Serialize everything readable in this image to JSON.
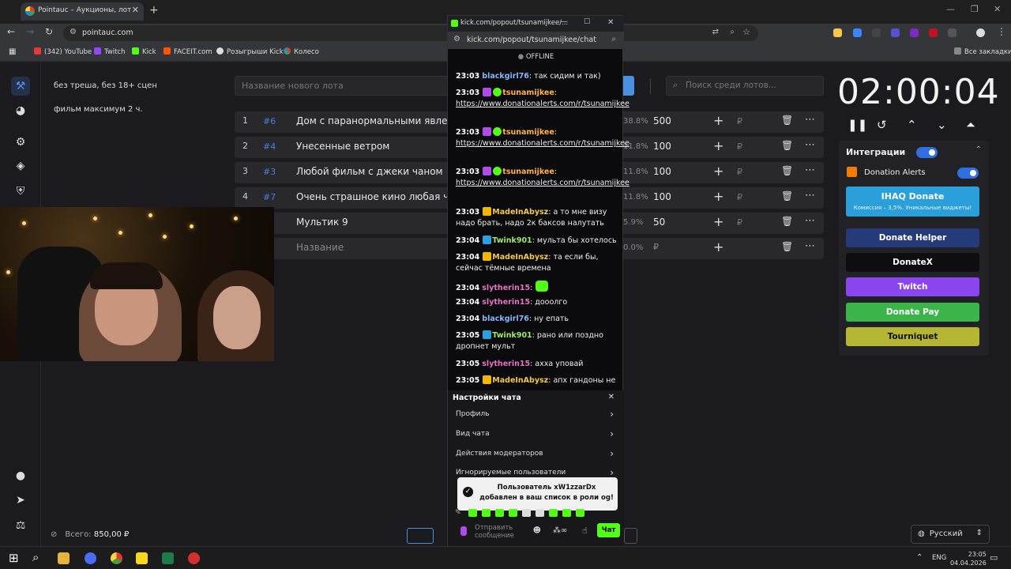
{
  "browser": {
    "tab_title": "Pointauc – Аукционы, лотереи...",
    "url": "pointauc.com",
    "bookmarks": [
      "(342) YouTube",
      "Twitch",
      "Kick",
      "FACEIT.com",
      "Розыгрыши Kick",
      "Колесо"
    ],
    "all_bookmarks": "Все закладки"
  },
  "rules": [
    "без треша, без 18+ сцен",
    "фильм максимум 2 ч."
  ],
  "lot_input_placeholder": "Название нового лота",
  "search_placeholder": "Поиск среди лотов...",
  "lots": [
    {
      "num": "1",
      "id": "#6",
      "name": "Дом с паранормальными явлени",
      "pct": "38.8%",
      "value": "500"
    },
    {
      "num": "2",
      "id": "#4",
      "name": "Унесенные ветром",
      "pct": "11.8%",
      "value": "100"
    },
    {
      "num": "3",
      "id": "#3",
      "name": "Любой фильм с джеки чаном",
      "pct": "11.8%",
      "value": "100"
    },
    {
      "num": "4",
      "id": "#7",
      "name": "Очень страшное кино любая час",
      "pct": "11.8%",
      "value": "100"
    },
    {
      "num": "",
      "id": "",
      "name": "Мультик 9",
      "pct": "5.9%",
      "value": "50"
    },
    {
      "num": "",
      "id": "",
      "name": "Название",
      "pct": "0.0%",
      "value": "₽"
    }
  ],
  "currency": "₽",
  "timer": "02:00:04",
  "integrations": {
    "title": "Интеграции",
    "donation_alerts": "Donation Alerts",
    "ihaq_title": "IHAQ Donate",
    "ihaq_sub": "Комиссия – 3,5%. Уникальные виджеты!",
    "services": [
      "Donate Helper",
      "DonateX",
      "Twitch",
      "Donate Pay",
      "Tourniquet"
    ]
  },
  "total_label": "Всего:",
  "total_value": "850,00 ₽",
  "language": "Русский",
  "popup": {
    "title": "kick.com/popout/tsunamijkee/...",
    "url": "kick.com/popout/tsunamijkee/chat",
    "status": "OFFLINE",
    "messages": [
      {
        "time": "23:03",
        "user": "blackgirl76",
        "color": "#8ab4ff",
        "text": "так сидим и так)"
      },
      {
        "time": "23:03",
        "user": "tsunamijkee",
        "color": "#ffb347",
        "text": "https://www.donationalerts.com/r/tsunamijkee"
      },
      {
        "time": "23:03",
        "user": "tsunamijkee",
        "color": "#ffb347",
        "text": "https://www.donationalerts.com/r/tsunamijkee"
      },
      {
        "time": "23:03",
        "user": "tsunamijkee",
        "color": "#ffb347",
        "text": "https://www.donationalerts.com/r/tsunamijkee"
      },
      {
        "time": "23:03",
        "user": "MadeInAbysz",
        "color": "#f2c94c",
        "text": "а то мне визу надо брать, надо 2к баксов налутать"
      },
      {
        "time": "23:04",
        "user": "Twink901",
        "color": "#a0e86f",
        "text": "мульта бы хотелось"
      },
      {
        "time": "23:04",
        "user": "MadeInAbysz",
        "color": "#f2c94c",
        "text": "та если бы, сейчас тёмные времена"
      },
      {
        "time": "23:04",
        "user": "slytherin15",
        "color": "#e573c6",
        "text": ""
      },
      {
        "time": "23:04",
        "user": "slytherin15",
        "color": "#e573c6",
        "text": "дооолго"
      },
      {
        "time": "23:04",
        "user": "blackgirl76",
        "color": "#8ab4ff",
        "text": "ну епать"
      },
      {
        "time": "23:05",
        "user": "Twink901",
        "color": "#a0e86f",
        "text": "рано или поздно дропнет мульт"
      },
      {
        "time": "23:05",
        "user": "slytherin15",
        "color": "#e573c6",
        "text": "ахха уповай"
      },
      {
        "time": "23:05",
        "user": "MadeInAbysz",
        "color": "#f2c94c",
        "text": "апх гандоны не"
      }
    ],
    "settings_title": "Настройки чата",
    "settings_items": [
      "Профиль",
      "Вид чата",
      "Действия модераторов",
      "Игнорируемые пользователи"
    ],
    "toast": "Пользователь xW1zzarDx добавлен в ваш список в роли og!",
    "input_placeholder": "Отправить сообщение",
    "chat_button": "Чат"
  },
  "taskbar": {
    "lang": "ENG",
    "time": "23:05",
    "date": "04.04.2026"
  }
}
